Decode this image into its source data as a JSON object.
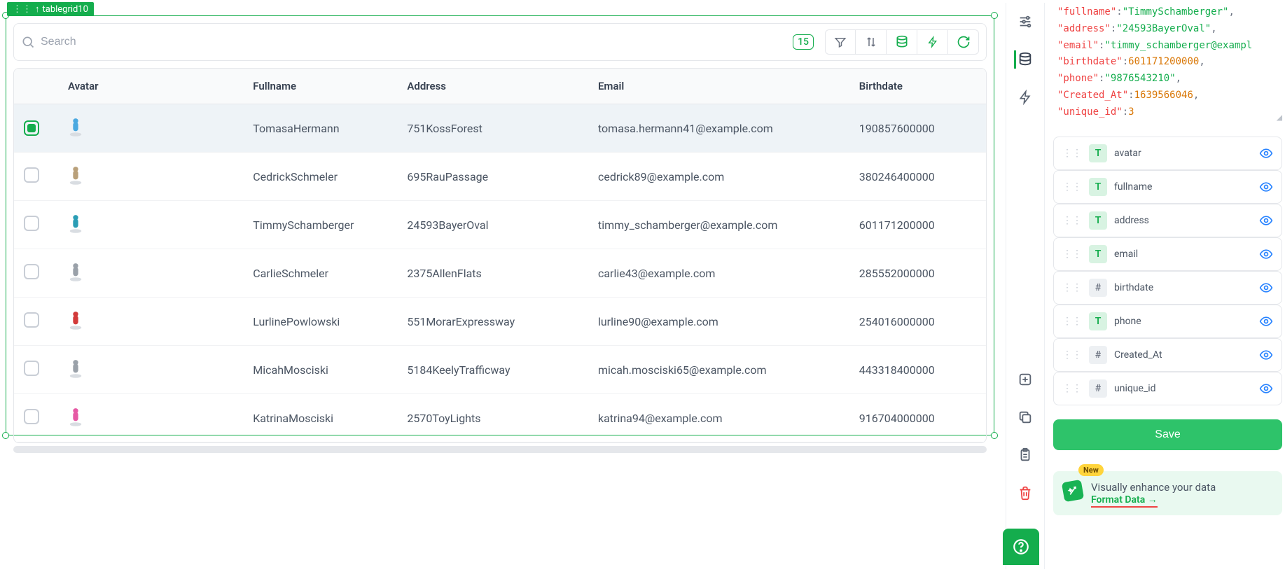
{
  "component": {
    "name": "tablegrid10"
  },
  "toolbar": {
    "search_placeholder": "Search",
    "row_count": "15"
  },
  "columns": [
    "Avatar",
    "Fullname",
    "Address",
    "Email",
    "Birthdate"
  ],
  "rows": [
    {
      "selected": true,
      "avatar_key": "blue",
      "fullname": "TomasaHermann",
      "address": "751KossForest",
      "email": "tomasa.hermann41@example.com",
      "birthdate": "190857600000"
    },
    {
      "selected": false,
      "avatar_key": "tan",
      "fullname": "CedrickSchmeler",
      "address": "695RauPassage",
      "email": "cedrick89@example.com",
      "birthdate": "380246400000"
    },
    {
      "selected": false,
      "avatar_key": "teal",
      "fullname": "TimmySchamberger",
      "address": "24593BayerOval",
      "email": "timmy_schamberger@example.com",
      "birthdate": "601171200000"
    },
    {
      "selected": false,
      "avatar_key": "grey",
      "fullname": "CarlieSchmeler",
      "address": "2375AllenFlats",
      "email": "carlie43@example.com",
      "birthdate": "285552000000"
    },
    {
      "selected": false,
      "avatar_key": "red",
      "fullname": "LurlinePowlowski",
      "address": "551MorarExpressway",
      "email": "lurline90@example.com",
      "birthdate": "254016000000"
    },
    {
      "selected": false,
      "avatar_key": "grey2",
      "fullname": "MicahMosciski",
      "address": "5184KeelyTrafficway",
      "email": "micah.mosciski65@example.com",
      "birthdate": "443318400000"
    },
    {
      "selected": false,
      "avatar_key": "pink",
      "fullname": "KatrinaMosciski",
      "address": "2570ToyLights",
      "email": "katrina94@example.com",
      "birthdate": "916704000000"
    }
  ],
  "code_sample": {
    "fullname": "TimmySchamberger",
    "address": "24593BayerOval",
    "email": "timmy_schamberger@exampl",
    "birthdate": "601171200000",
    "phone": "9876543210",
    "Created_At": "1639566046",
    "unique_id": "3"
  },
  "fields": [
    {
      "name": "avatar",
      "type": "text"
    },
    {
      "name": "fullname",
      "type": "text"
    },
    {
      "name": "address",
      "type": "text"
    },
    {
      "name": "email",
      "type": "text"
    },
    {
      "name": "birthdate",
      "type": "num"
    },
    {
      "name": "phone",
      "type": "text"
    },
    {
      "name": "Created_At",
      "type": "num"
    },
    {
      "name": "unique_id",
      "type": "num"
    }
  ],
  "buttons": {
    "save": "Save"
  },
  "promo": {
    "badge": "New",
    "text": "Visually enhance your data",
    "link": "Format Data"
  },
  "avatar_colors": {
    "blue": "#4aa8e0",
    "tan": "#b9a07a",
    "teal": "#2a9db5",
    "grey": "#9aa1a9",
    "red": "#d23a3a",
    "grey2": "#9aa1a9",
    "pink": "#e65aa5"
  }
}
